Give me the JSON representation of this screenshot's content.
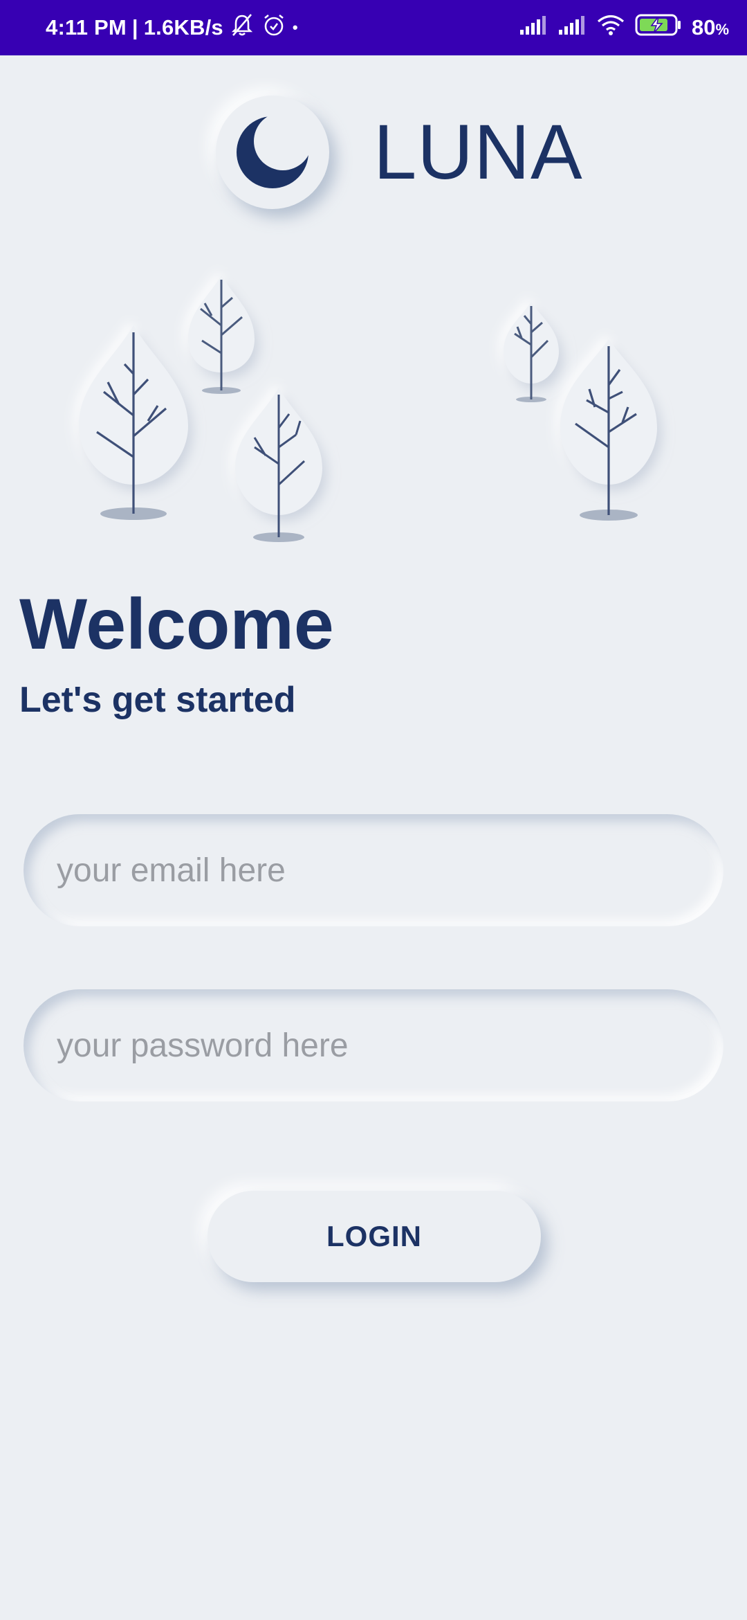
{
  "status_bar": {
    "time": "4:11 PM",
    "separator": "|",
    "network_speed": "1.6KB/s",
    "dot": "•",
    "battery_percent": "80",
    "battery_unit": "%",
    "icons": [
      "mute-bell-icon",
      "alarm-icon",
      "signal-icon",
      "signal-icon",
      "wifi-icon",
      "battery-charging-icon"
    ],
    "background_color": "#3700b3"
  },
  "logo": {
    "icon": "crescent-moon-icon",
    "app_name": "LUNA"
  },
  "illustration": {
    "icon": "trees-illustration"
  },
  "header": {
    "title": "Welcome",
    "subtitle": "Let's get started"
  },
  "form": {
    "email_placeholder": "your email here",
    "password_placeholder": "your password here",
    "login_label": "LOGIN"
  },
  "colors": {
    "primary_text": "#1c3264",
    "background": "#eceff3",
    "placeholder": "#9a9da3"
  }
}
